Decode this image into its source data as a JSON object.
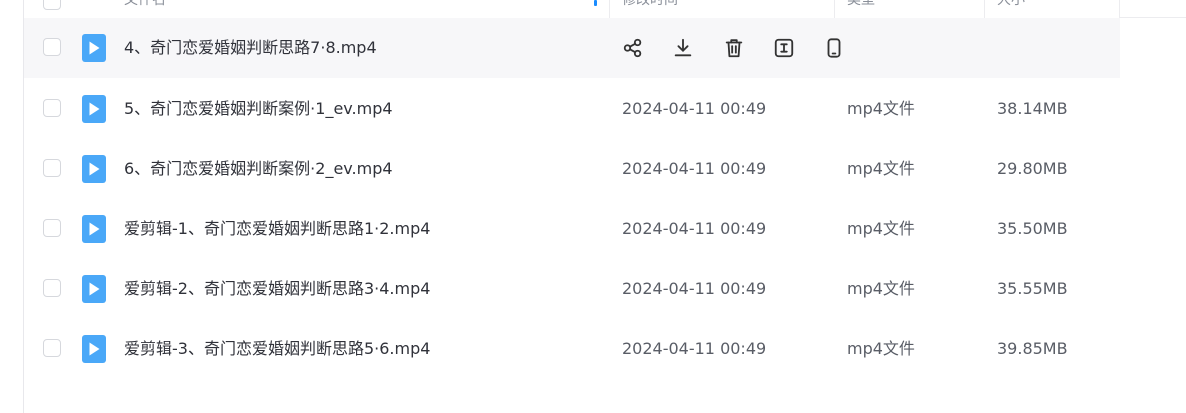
{
  "header": {
    "name_label": "文件名",
    "modified_label": "修改时间",
    "type_label": "类型",
    "size_label": "大小"
  },
  "row_actions": [
    {
      "icon": "share-icon"
    },
    {
      "icon": "download-icon"
    },
    {
      "icon": "delete-icon"
    },
    {
      "icon": "rename-icon"
    },
    {
      "icon": "phone-icon"
    }
  ],
  "files": [
    {
      "name": "4、奇门恋爱婚姻判断思路7·8.mp4",
      "date": "",
      "type": "",
      "size": "",
      "hovered": true
    },
    {
      "name": "5、奇门恋爱婚姻判断案例·1_ev.mp4",
      "date": "2024-04-11 00:49",
      "type": "mp4文件",
      "size": "38.14MB"
    },
    {
      "name": "6、奇门恋爱婚姻判断案例·2_ev.mp4",
      "date": "2024-04-11 00:49",
      "type": "mp4文件",
      "size": "29.80MB"
    },
    {
      "name": "爱剪辑-1、奇门恋爱婚姻判断思路1·2.mp4",
      "date": "2024-04-11 00:49",
      "type": "mp4文件",
      "size": "35.50MB"
    },
    {
      "name": "爱剪辑-2、奇门恋爱婚姻判断思路3·4.mp4",
      "date": "2024-04-11 00:49",
      "type": "mp4文件",
      "size": "35.55MB"
    },
    {
      "name": "爱剪辑-3、奇门恋爱婚姻判断思路5·6.mp4",
      "date": "2024-04-11 00:49",
      "type": "mp4文件",
      "size": "39.85MB"
    }
  ],
  "colors": {
    "file_icon": "#4aa8f8",
    "hover_bg": "#f7f7f9",
    "accent": "#1a8cff"
  }
}
